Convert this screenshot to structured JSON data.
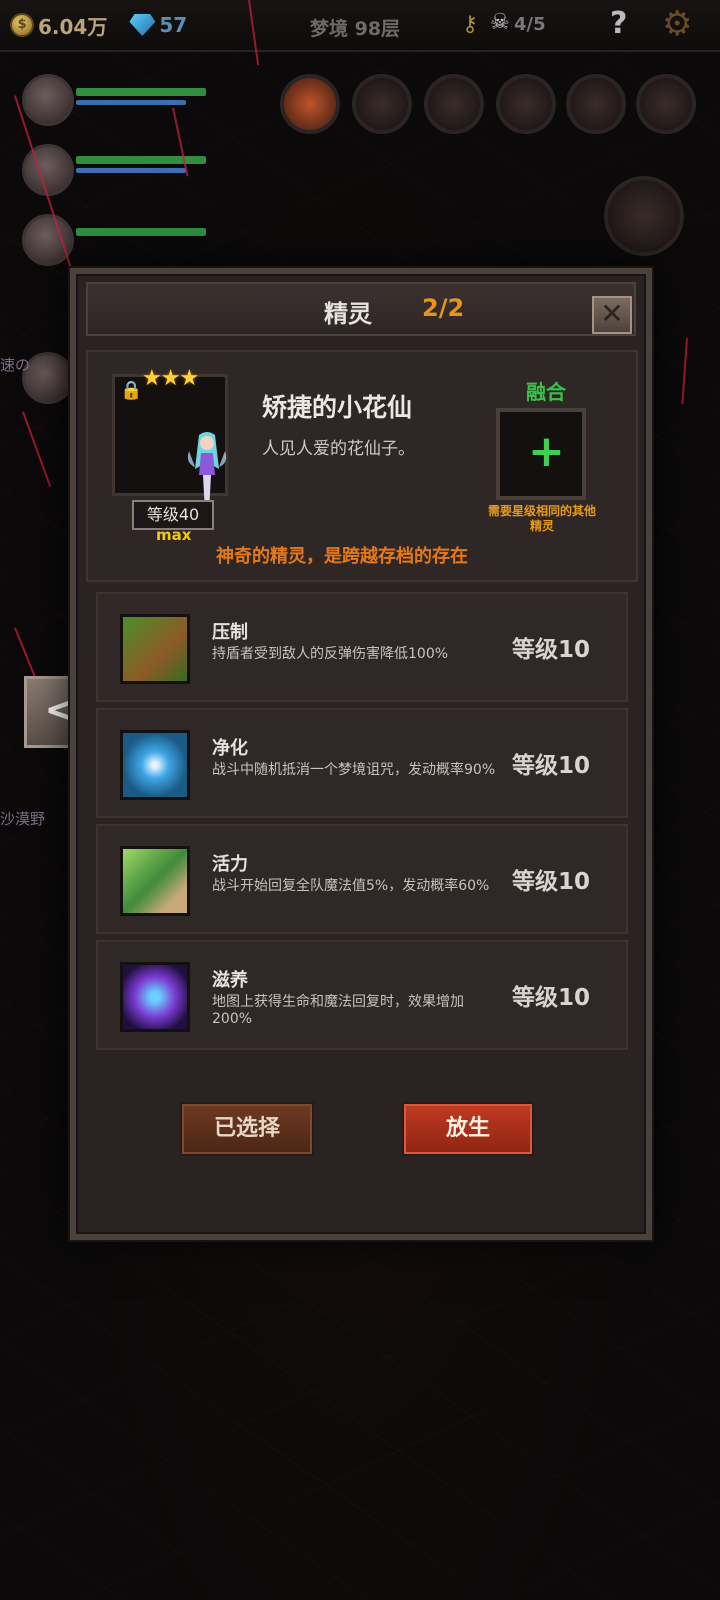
{
  "topbar": {
    "coins": "6.04万",
    "coin_glyph": "$",
    "gems": "57",
    "floor": "梦境 98层",
    "skulls": "4/5",
    "help": "?"
  },
  "background": {
    "partial_text_left": "沙漠野",
    "partial_text_left2": "速の"
  },
  "modal": {
    "title": "精灵",
    "count": "2/2",
    "close_symbol": "✕",
    "spirit": {
      "stars": "★★★",
      "level": "等级40",
      "max": "max",
      "name": "矫捷的小花仙",
      "description": "人见人爱的花仙子。",
      "tagline": "神奇的精灵，是跨越存档的存在"
    },
    "fuse": {
      "label": "融合",
      "plus": "+",
      "note": "需要星级相同的其他精灵"
    },
    "skills": [
      {
        "name": "压制",
        "desc": "持盾者受到敌人的反弹伤害降低100%",
        "level": "等级10"
      },
      {
        "name": "净化",
        "desc": "战斗中随机抵消一个梦境诅咒，发动概率90%",
        "level": "等级10"
      },
      {
        "name": "活力",
        "desc": "战斗开始回复全队魔法值5%，发动概率60%",
        "level": "等级10"
      },
      {
        "name": "滋养",
        "desc": "地图上获得生命和魔法回复时，效果增加200%",
        "level": "等级10"
      }
    ],
    "buttons": {
      "selected": "已选择",
      "release": "放生"
    }
  },
  "nav": {
    "left_arrow": "<"
  }
}
